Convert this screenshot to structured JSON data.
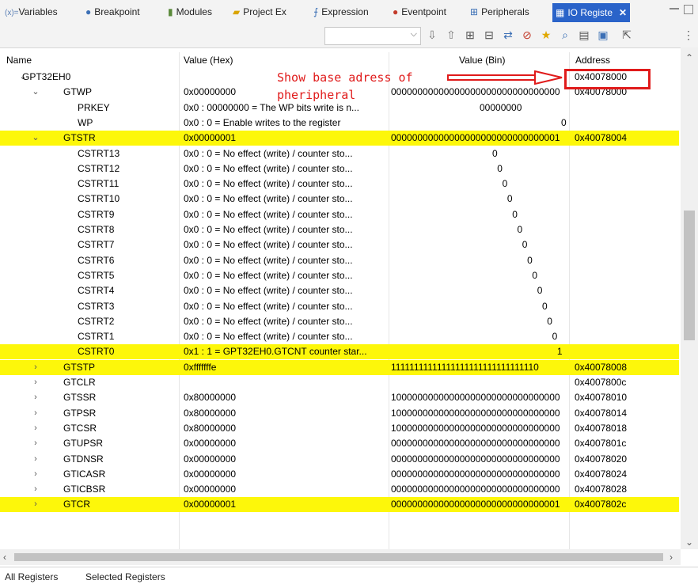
{
  "tabs": [
    {
      "label": "Variables",
      "icon": "variables-icon",
      "glyph": "(x)=",
      "color": "#5a7fb5"
    },
    {
      "label": "Breakpoint",
      "icon": "breakpoint-icon",
      "glyph": "●",
      "color": "#3b6fb5"
    },
    {
      "label": "Modules",
      "icon": "modules-icon",
      "glyph": "▮",
      "color": "#5a8a3a"
    },
    {
      "label": "Project Ex",
      "icon": "project-explorer-icon",
      "glyph": "▰",
      "color": "#d9a400"
    },
    {
      "label": "Expression",
      "icon": "expression-icon",
      "glyph": "⨍",
      "color": "#3b6fb5"
    },
    {
      "label": "Eventpoint",
      "icon": "eventpoint-icon",
      "glyph": "●",
      "color": "#c23a2a"
    },
    {
      "label": "Peripherals",
      "icon": "peripherals-icon",
      "glyph": "⊞",
      "color": "#3b6fb5"
    },
    {
      "label": "IO Registe",
      "icon": "io-registers-icon",
      "glyph": "▦",
      "color": "#ffffff",
      "active": true
    }
  ],
  "columns": {
    "name": "Name",
    "hex": "Value (Hex)",
    "bin": "Value (Bin)",
    "address": "Address"
  },
  "annotation": {
    "line1": "Show base adress of",
    "line2": "pheripheral",
    "color": "#e01b1b"
  },
  "highlight_color": "#fdf70a",
  "rows": [
    {
      "level": 0,
      "expander": "down",
      "name": "GPT32EH0",
      "hex": "",
      "bin": "",
      "address": "0x40078000",
      "hl": false
    },
    {
      "level": 1,
      "expander": "down",
      "name": "GTWP",
      "hex": "0x00000000",
      "bin": "00000000000000000000000000000000",
      "address": "0x40078000",
      "hl": false
    },
    {
      "level": 2,
      "expander": "",
      "name": "PRKEY",
      "hex": "0x0 : 00000000 = The WP bits write is n...",
      "bin": "00000000",
      "address": "",
      "hl": false
    },
    {
      "level": 2,
      "expander": "",
      "name": "WP",
      "hex": "0x0 : 0 = Enable writes to the register",
      "bin": "0",
      "address": "",
      "hl": false
    },
    {
      "level": 1,
      "expander": "down",
      "name": "GTSTR",
      "hex": "0x00000001",
      "bin": "00000000000000000000000000000001",
      "address": "0x40078004",
      "hl": true
    },
    {
      "level": 2,
      "expander": "",
      "name": "CSTRT13",
      "hex": "0x0 : 0 = No effect (write) / counter sto...",
      "bin": "0",
      "address": "",
      "hl": false
    },
    {
      "level": 2,
      "expander": "",
      "name": "CSTRT12",
      "hex": "0x0 : 0 = No effect (write) / counter sto...",
      "bin": "0",
      "address": "",
      "hl": false
    },
    {
      "level": 2,
      "expander": "",
      "name": "CSTRT11",
      "hex": "0x0 : 0 = No effect (write) / counter sto...",
      "bin": "0",
      "address": "",
      "hl": false
    },
    {
      "level": 2,
      "expander": "",
      "name": "CSTRT10",
      "hex": "0x0 : 0 = No effect (write) / counter sto...",
      "bin": "0",
      "address": "",
      "hl": false
    },
    {
      "level": 2,
      "expander": "",
      "name": "CSTRT9",
      "hex": "0x0 : 0 = No effect (write) / counter sto...",
      "bin": "0",
      "address": "",
      "hl": false
    },
    {
      "level": 2,
      "expander": "",
      "name": "CSTRT8",
      "hex": "0x0 : 0 = No effect (write) / counter sto...",
      "bin": "0",
      "address": "",
      "hl": false
    },
    {
      "level": 2,
      "expander": "",
      "name": "CSTRT7",
      "hex": "0x0 : 0 = No effect (write) / counter sto...",
      "bin": "0",
      "address": "",
      "hl": false
    },
    {
      "level": 2,
      "expander": "",
      "name": "CSTRT6",
      "hex": "0x0 : 0 = No effect (write) / counter sto...",
      "bin": "0",
      "address": "",
      "hl": false
    },
    {
      "level": 2,
      "expander": "",
      "name": "CSTRT5",
      "hex": "0x0 : 0 = No effect (write) / counter sto...",
      "bin": "0",
      "address": "",
      "hl": false
    },
    {
      "level": 2,
      "expander": "",
      "name": "CSTRT4",
      "hex": "0x0 : 0 = No effect (write) / counter sto...",
      "bin": "0",
      "address": "",
      "hl": false
    },
    {
      "level": 2,
      "expander": "",
      "name": "CSTRT3",
      "hex": "0x0 : 0 = No effect (write) / counter sto...",
      "bin": "0",
      "address": "",
      "hl": false
    },
    {
      "level": 2,
      "expander": "",
      "name": "CSTRT2",
      "hex": "0x0 : 0 = No effect (write) / counter sto...",
      "bin": "0",
      "address": "",
      "hl": false
    },
    {
      "level": 2,
      "expander": "",
      "name": "CSTRT1",
      "hex": "0x0 : 0 = No effect (write) / counter sto...",
      "bin": "0",
      "address": "",
      "hl": false
    },
    {
      "level": 2,
      "expander": "",
      "name": "CSTRT0",
      "hex": "0x1 : 1 = GPT32EH0.GTCNT counter star...",
      "bin": "1",
      "address": "",
      "hl": true
    },
    {
      "level": 1,
      "expander": "right",
      "name": "GTSTP",
      "hex": "0xfffffffe",
      "bin": "11111111111111111111111111111110",
      "address": "0x40078008",
      "hl": true
    },
    {
      "level": 1,
      "expander": "right",
      "name": "GTCLR",
      "hex": "",
      "bin": "",
      "address": "0x4007800c",
      "hl": false
    },
    {
      "level": 1,
      "expander": "right",
      "name": "GTSSR",
      "hex": "0x80000000",
      "bin": "10000000000000000000000000000000",
      "address": "0x40078010",
      "hl": false
    },
    {
      "level": 1,
      "expander": "right",
      "name": "GTPSR",
      "hex": "0x80000000",
      "bin": "10000000000000000000000000000000",
      "address": "0x40078014",
      "hl": false
    },
    {
      "level": 1,
      "expander": "right",
      "name": "GTCSR",
      "hex": "0x80000000",
      "bin": "10000000000000000000000000000000",
      "address": "0x40078018",
      "hl": false
    },
    {
      "level": 1,
      "expander": "right",
      "name": "GTUPSR",
      "hex": "0x00000000",
      "bin": "00000000000000000000000000000000",
      "address": "0x4007801c",
      "hl": false
    },
    {
      "level": 1,
      "expander": "right",
      "name": "GTDNSR",
      "hex": "0x00000000",
      "bin": "00000000000000000000000000000000",
      "address": "0x40078020",
      "hl": false
    },
    {
      "level": 1,
      "expander": "right",
      "name": "GTICASR",
      "hex": "0x00000000",
      "bin": "00000000000000000000000000000000",
      "address": "0x40078024",
      "hl": false
    },
    {
      "level": 1,
      "expander": "right",
      "name": "GTICBSR",
      "hex": "0x00000000",
      "bin": "00000000000000000000000000000000",
      "address": "0x40078028",
      "hl": false
    },
    {
      "level": 1,
      "expander": "right",
      "name": "GTCR",
      "hex": "0x00000001",
      "bin": "00000000000000000000000000000001",
      "address": "0x4007802c",
      "hl": true
    }
  ],
  "bottom_tabs": [
    {
      "label": "All Registers"
    },
    {
      "label": "Selected Registers"
    }
  ]
}
